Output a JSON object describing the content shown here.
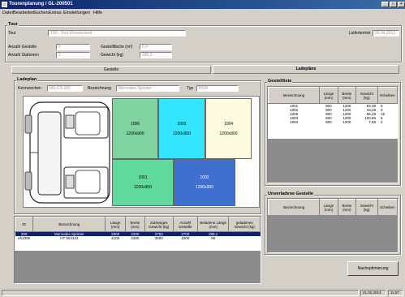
{
  "window": {
    "title": "Tourenplanung / GL-200501"
  },
  "menu": [
    "Datei",
    "Bearbeiten",
    "Suchen",
    "Extras",
    "Einstellungen",
    "Hilfe"
  ],
  "tour_group": {
    "label": "Tour",
    "tour_label": "Tour",
    "tour_value": "100 - Tour Münsterland",
    "liefertermin_label": "Liefertermin",
    "liefertermin_value": "06.04.2013",
    "anzahl_gestelle_label": "Anzahl Gestelle",
    "anzahl_gestelle_value": "6",
    "anzahl_stationen_label": "Anzahl Stationen",
    "anzahl_stationen_value": "2",
    "gestellflaeche_label": "Gestellfläche (m²)",
    "gestellflaeche_value": "6,4",
    "gewicht_label": "Gewicht (kg)",
    "gewicht_value": "395,3"
  },
  "tabs": {
    "gestelle": "Gestelle",
    "ladeplaene": "Ladepläne"
  },
  "ladeplan": {
    "label": "Ladeplan",
    "kennzeichen_label": "Kennzeichen",
    "kennzeichen_value": "MS-CS 200",
    "bezeichnung_label": "Bezeichnung",
    "bezeichnung_value": "Mercedes Sprinter",
    "typ_label": "Typ",
    "typ_value": "PKW",
    "racks": [
      {
        "id": "1006",
        "size": "1200x900",
        "color": "#7ed3a0"
      },
      {
        "id": "1003",
        "size": "1200x900",
        "color": "#33e5ff"
      },
      {
        "id": "1004",
        "size": "1200x900",
        "color": "#fcfbe0"
      },
      {
        "id": "1001",
        "size": "1200x900",
        "color": "#5fd99c"
      },
      {
        "id": "1002",
        "size": "1200x900",
        "color": "#3f6fcf"
      }
    ]
  },
  "vehicle_table": {
    "headers": [
      "ID",
      "Bezeichnung",
      "Länge (mm)",
      "Breite (mm)",
      "Zulässiges Gewicht (kg)",
      "Anzahl Gestelle",
      "Beladene Länge (mm)",
      "geladenes Gewicht (kg)"
    ],
    "rows": [
      [
        "200",
        "Mercedes Sprinter",
        "2800",
        "2200",
        "2750",
        "2700",
        "299,1",
        ""
      ],
      [
        "eh1000",
        "HT 504124",
        "4100",
        "2480",
        "3500",
        "1000",
        "95",
        ""
      ]
    ]
  },
  "gestellliste": {
    "label": "Gestellliste",
    "headers": [
      "Bezeichnung",
      "Länge (mm)",
      "Breite (mm)",
      "Gewicht (kg)",
      "Scheiben"
    ],
    "rows": [
      [
        "1001",
        "900",
        "1200",
        "83,36",
        "6"
      ],
      [
        "1002",
        "900",
        "1200",
        "43,29",
        "3"
      ],
      [
        "1006",
        "900",
        "1200",
        "56,25",
        "15"
      ],
      [
        "1003",
        "900",
        "1200",
        "100,86",
        "6"
      ],
      [
        "1004",
        "900",
        "1200",
        "7,65",
        "2"
      ]
    ]
  },
  "unverladene": {
    "label": "Unverladene Gestelle",
    "headers": [
      "Bezeichnung",
      "Länge (mm)",
      "Breite (mm)",
      "Gewicht (kg)",
      "Scheiben"
    ]
  },
  "buttons": {
    "nachoptimierung": "Nachoptimierung"
  },
  "status": {
    "date": "21.02.2013",
    "time": "11:57"
  }
}
